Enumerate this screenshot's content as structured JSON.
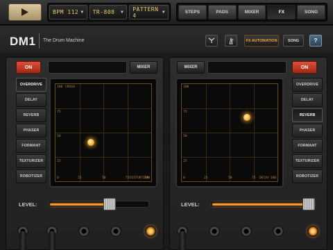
{
  "toolbar": {
    "bpm": "BPM 112",
    "kit": "TR-808",
    "pattern": "PATTERN 4",
    "nav_tabs": [
      "STEPS",
      "PADS",
      "MIXER",
      "FX",
      "SONG"
    ],
    "active_tab": "FX"
  },
  "header": {
    "logo": "DM1",
    "subtitle": "The Drum Machine",
    "fx_automation": "FX AUTOMATION",
    "song": "SONG",
    "help": "?"
  },
  "left_panel": {
    "on_label": "ON",
    "mixer_label": "MIXER",
    "effects": [
      "OVERDRIVE",
      "DELAY",
      "REVERB",
      "PHASER",
      "FORMANT",
      "TEXTURIZER",
      "ROBOTIZER"
    ],
    "active_effect": "OVERDRIVE",
    "y_param": "CRUSH",
    "x_param": "DISTORTION",
    "y_ticks": [
      "100",
      "75",
      "50",
      "25",
      "0"
    ],
    "x_ticks": [
      "25",
      "50",
      "75",
      "100"
    ],
    "x_value": 37,
    "y_value": 40,
    "level_label": "LEVEL:",
    "level": 0.62
  },
  "right_panel": {
    "on_label": "ON",
    "mixer_label": "MIXER",
    "effects": [
      "OVERDRIVE",
      "DELAY",
      "REVERB",
      "PHASER",
      "FORMANT",
      "TEXTURIZER",
      "ROBOTIZER"
    ],
    "active_effect": "REVERB",
    "y_param": "",
    "x_param": "DECAY",
    "y_ticks": [
      "100",
      "75",
      "50",
      "25",
      "0"
    ],
    "x_ticks": [
      "25",
      "50",
      "75",
      "100"
    ],
    "x_value": 68,
    "y_value": 66,
    "level_label": "LEVEL:",
    "level": 0.97
  }
}
